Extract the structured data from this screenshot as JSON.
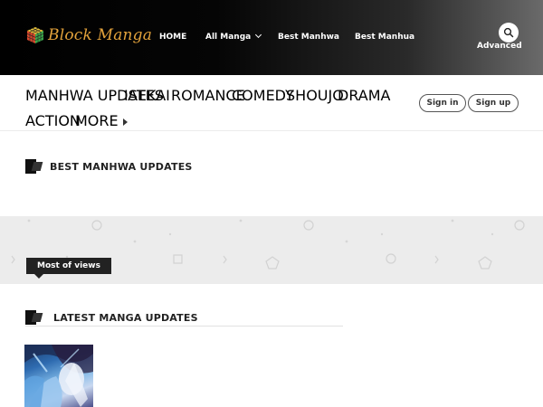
{
  "header": {
    "logo_text": "Block Manga",
    "nav": [
      {
        "label": "HOME"
      },
      {
        "label": "All Manga",
        "has_dropdown": true
      },
      {
        "label": "Best Manhwa"
      },
      {
        "label": "Best Manhua"
      }
    ],
    "search_icon": "search-icon",
    "advanced_label": "Advanced"
  },
  "genres": [
    {
      "label": "MANHWA UPDATES"
    },
    {
      "label": "ISEKAI"
    },
    {
      "label": "ROMANCE"
    },
    {
      "label": "COMEDY"
    },
    {
      "label": "SHOUJO"
    },
    {
      "label": "DRAMA"
    },
    {
      "label": "ACTION"
    },
    {
      "label": "MORE"
    }
  ],
  "auth": {
    "sign_in": "Sign in",
    "sign_up": "Sign up"
  },
  "sections": {
    "best_manhwa": "BEST MANHWA UPDATES",
    "most_views": "Most of views",
    "latest": "LATEST MANGA UPDATES"
  },
  "colors": {
    "logo": "#e3a23b",
    "header_bg_start": "#000000",
    "header_bg_end": "#6a6a6a",
    "band_bg": "#ececec"
  }
}
